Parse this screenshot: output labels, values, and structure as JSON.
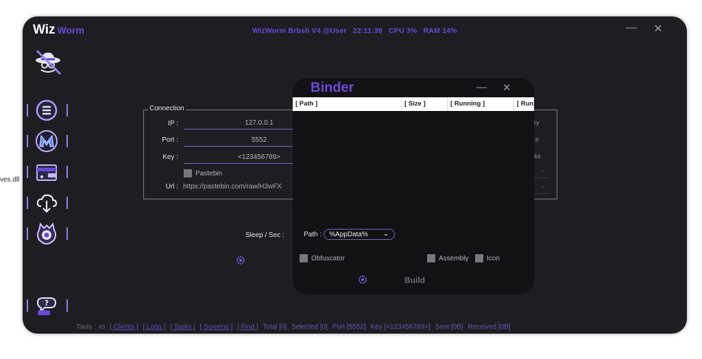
{
  "desktop": {
    "stray_text": "ves.dll"
  },
  "app": {
    "logo_main": "Wiz",
    "logo_sub": "Worm",
    "title": {
      "name": "WizWorm Brbsh V4 @User",
      "time": "22:11:39",
      "cpu": "CPU 3%",
      "ram": "RAM 14%"
    },
    "window_buttons": {
      "minimize": "—",
      "close": "✕"
    }
  },
  "sidebar": {
    "items": [
      {
        "name": "menu",
        "icon": "menu-icon"
      },
      {
        "name": "malware",
        "icon": "malware-logo-icon"
      },
      {
        "name": "wallet",
        "icon": "wallet-icon"
      },
      {
        "name": "cloud-download",
        "icon": "cloud-download-icon"
      },
      {
        "name": "monster",
        "icon": "monster-icon"
      },
      {
        "name": "help",
        "icon": "chat-help-icon"
      }
    ]
  },
  "connection": {
    "legend": "Connection",
    "ip_label": "IP :",
    "ip_value": "127.0.0.1",
    "port_label": "Port :",
    "port_value": "5552",
    "key_label": "Key :",
    "key_value": "<123456789>",
    "pastebin_label": "Pastebin",
    "url_label": "Url :",
    "url_value": "https://pastebin.com/raw/H3wFX"
  },
  "right_options": {
    "opt1": "ry",
    "opt2": "p",
    "opt3": "sks"
  },
  "sleep_label": "Sleep / Sec :",
  "status_bar": {
    "tools": "Tools :",
    "clients": "[ Clients ]",
    "logs": "[ Logs ]",
    "tasks": "[ Tasks ]",
    "screens": "[ Screens ]",
    "find": "[ Find ]",
    "total": "Total [0]",
    "selected": "Selected [0]",
    "port": "Port [5552]",
    "key": "Key [<123456789>]",
    "sent": "Sent [0B]",
    "received": "Received [0B]"
  },
  "binder": {
    "title": "Binder",
    "minimize": "—",
    "close": "✕",
    "columns": [
      "[ Path ]",
      "[ Size ]",
      "[ Running ]",
      "[ Run"
    ],
    "path_label": "Path :",
    "path_value": "%AppData%",
    "obfuscator_label": "Obfuscator",
    "assembly_label": "Assembly",
    "icon_label": "Icon",
    "build_label": "Build"
  },
  "colors": {
    "accent": "#6a48d8",
    "window_bg": "#1e1e22",
    "binder_bg": "#121214"
  }
}
